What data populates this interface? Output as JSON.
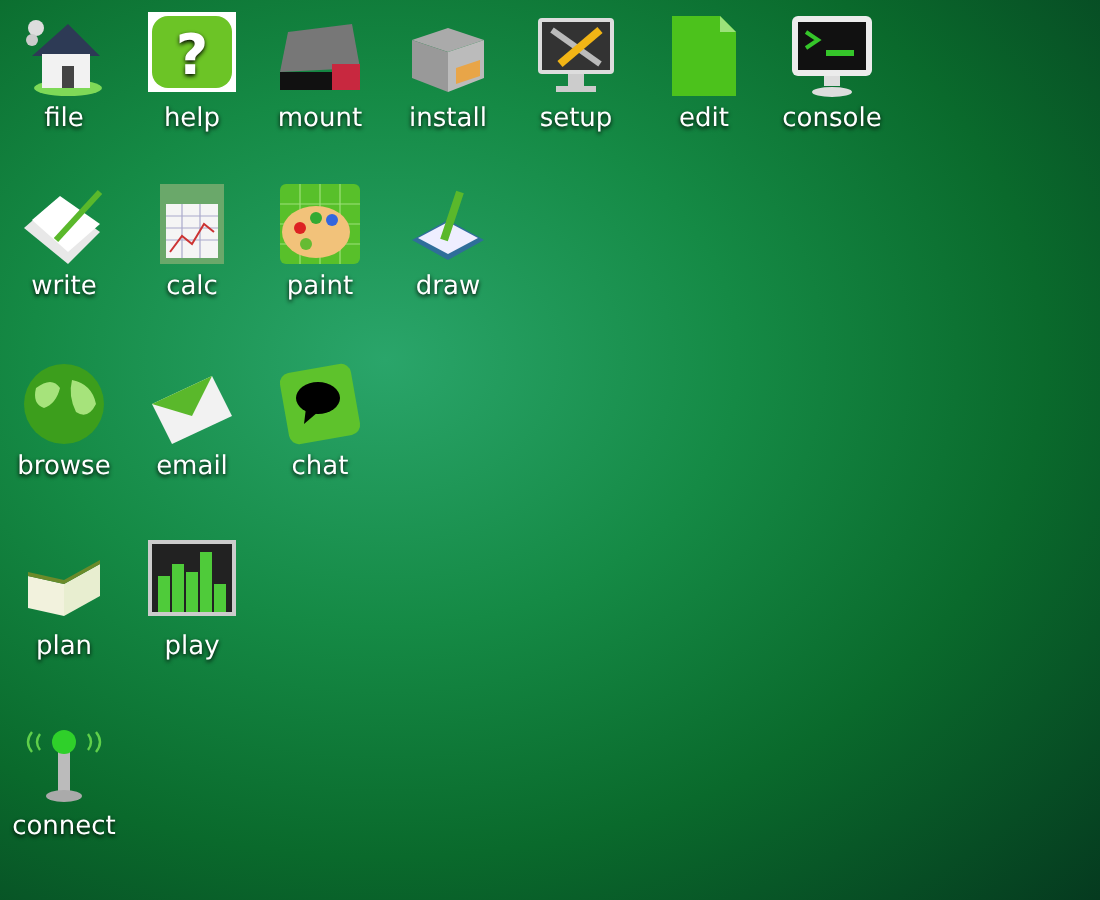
{
  "desktop_rows": [
    [
      {
        "label": "file",
        "kind": "house"
      },
      {
        "label": "help",
        "kind": "help",
        "glyph": "?"
      },
      {
        "label": "mount",
        "kind": "drive"
      },
      {
        "label": "install",
        "kind": "box"
      },
      {
        "label": "setup",
        "kind": "tools"
      },
      {
        "label": "edit",
        "kind": "page"
      },
      {
        "label": "console",
        "kind": "terminal"
      }
    ],
    [
      {
        "label": "write",
        "kind": "write"
      },
      {
        "label": "calc",
        "kind": "sheet"
      },
      {
        "label": "paint",
        "kind": "palette"
      },
      {
        "label": "draw",
        "kind": "draw"
      }
    ],
    [
      {
        "label": "browse",
        "kind": "globe"
      },
      {
        "label": "email",
        "kind": "mail"
      },
      {
        "label": "chat",
        "kind": "chat"
      }
    ],
    [
      {
        "label": "plan",
        "kind": "book"
      },
      {
        "label": "play",
        "kind": "meter"
      }
    ],
    [
      {
        "label": "connect",
        "kind": "antenna"
      }
    ]
  ]
}
